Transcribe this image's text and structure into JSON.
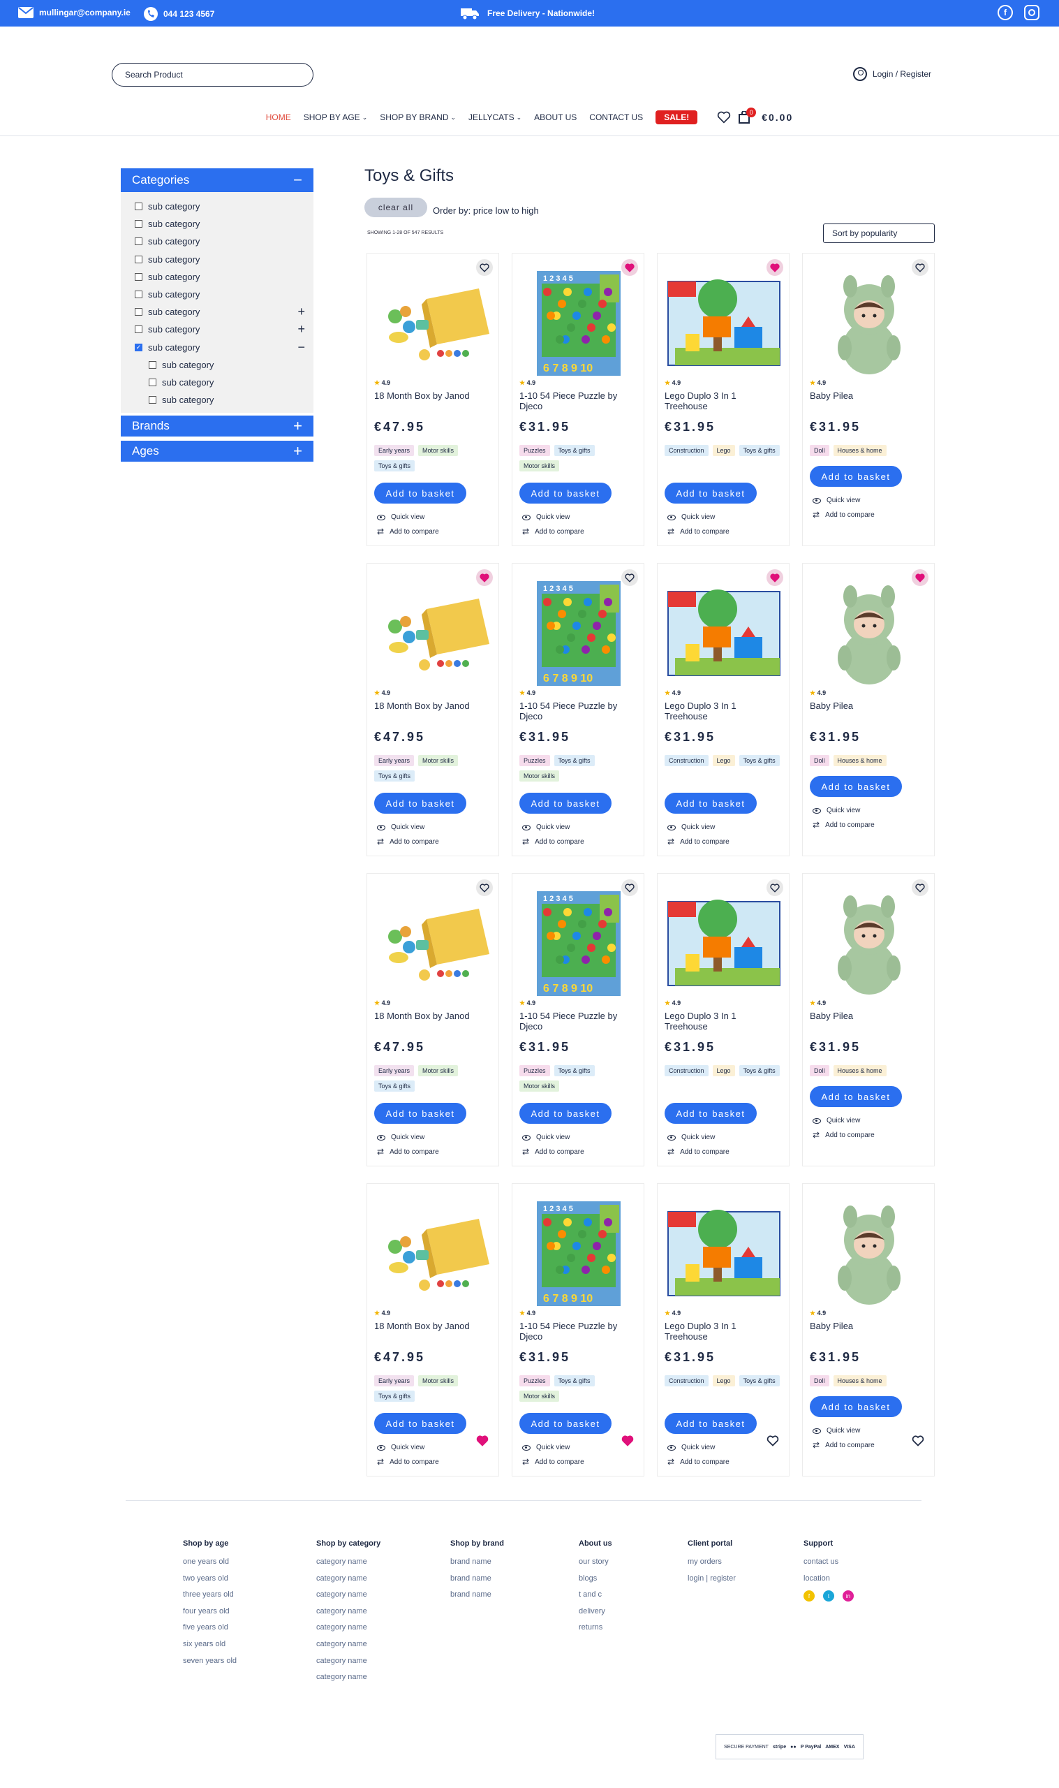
{
  "topbar": {
    "email": "mullingar@company.ie",
    "phone": "044 123 4567",
    "delivery": "Free Delivery - Nationwide!"
  },
  "header": {
    "search_placeholder": "Search Product",
    "login": "Login / Register"
  },
  "nav": {
    "items": [
      "HOME",
      "SHOP BY AGE",
      "SHOP BY BRAND",
      "JELLYCATS",
      "ABOUT US",
      "CONTACT US"
    ],
    "sale": "SALE!",
    "cart_count": "0",
    "cart_total": "€0.00"
  },
  "sidebar": {
    "categories_title": "Categories",
    "categories": [
      {
        "label": "sub category",
        "checked": false
      },
      {
        "label": "sub category",
        "checked": false
      },
      {
        "label": "sub category",
        "checked": false
      },
      {
        "label": "sub category",
        "checked": false
      },
      {
        "label": "sub category",
        "checked": false
      },
      {
        "label": "sub category",
        "checked": false
      },
      {
        "label": "sub category",
        "checked": false,
        "expand": "+"
      },
      {
        "label": "sub category",
        "checked": false,
        "expand": "+"
      },
      {
        "label": "sub category",
        "checked": true,
        "expand": "−"
      }
    ],
    "subcategories": [
      "sub category",
      "sub category",
      "sub category"
    ],
    "brands_title": "Brands",
    "ages_title": "Ages"
  },
  "main": {
    "title": "Toys & Gifts",
    "clear_all": "clear all",
    "order_by": "Order by: price low to high",
    "showing": "SHOWING 1-28 OF 547 RESULTS",
    "sort": "Sort by popularity"
  },
  "product_labels": {
    "rating": "4.9",
    "add_to_basket": "Add to basket",
    "quick_view": "Quick view",
    "add_to_compare": "Add to compare"
  },
  "products": [
    {
      "name": "18 Month Box by Janod",
      "price": "€47.95",
      "tags": [
        "Early years",
        "Motor skills",
        "Toys & gifts"
      ]
    },
    {
      "name": "1-10 54 Piece Puzzle by Djeco",
      "price": "€31.95",
      "tags": [
        "Puzzles",
        "Toys & gifts",
        "Motor skills"
      ]
    },
    {
      "name": "Lego Duplo 3 In 1 Treehouse",
      "price": "€31.95",
      "tags": [
        "Construction",
        "Lego",
        "Toys & gifts"
      ]
    },
    {
      "name": "Baby Pilea",
      "price": "€31.95",
      "tags": [
        "Doll",
        "Houses & home"
      ]
    }
  ],
  "rows": [
    {
      "favs": [
        false,
        true,
        true,
        false
      ],
      "fav_pos": "top"
    },
    {
      "favs": [
        true,
        false,
        true,
        true
      ],
      "fav_pos": "top"
    },
    {
      "favs": [
        false,
        false,
        false,
        false
      ],
      "fav_pos": "top"
    },
    {
      "favs": [
        true,
        true,
        false,
        false
      ],
      "fav_pos": "bottom"
    }
  ],
  "footer": {
    "columns": [
      {
        "title": "Shop by age",
        "links": [
          "one years old",
          "two years old",
          "three years old",
          "four years old",
          "five years old",
          "six years old",
          "seven years old"
        ]
      },
      {
        "title": "Shop by category",
        "links": [
          "category name",
          "category name",
          "category name",
          "category name",
          "category name",
          "category name",
          "category name",
          "category name"
        ]
      },
      {
        "title": "Shop by brand",
        "links": [
          "brand name",
          "brand name",
          "brand name"
        ]
      },
      {
        "title": "About us",
        "links": [
          "our story",
          "blogs",
          "t and c",
          "delivery",
          "returns"
        ]
      },
      {
        "title": "Client portal",
        "links": [
          "my orders",
          "login | register"
        ]
      },
      {
        "title": "Support",
        "links": [
          "contact us",
          "location"
        ]
      }
    ],
    "socials": [
      {
        "icon": "facebook-icon",
        "color": "#f2c200",
        "glyph": "f"
      },
      {
        "icon": "twitter-icon",
        "color": "#1aa6d8",
        "glyph": "t"
      },
      {
        "icon": "linkedin-icon",
        "color": "#e02098",
        "glyph": "in"
      }
    ],
    "payments": [
      "SECURE PAYMENT",
      "stripe",
      "●●",
      "P PayPal",
      "AMEX",
      "VISA"
    ]
  },
  "colors": {
    "accent": "#2b6fef",
    "sale": "#e02020",
    "fav_on": "#e0107a"
  }
}
